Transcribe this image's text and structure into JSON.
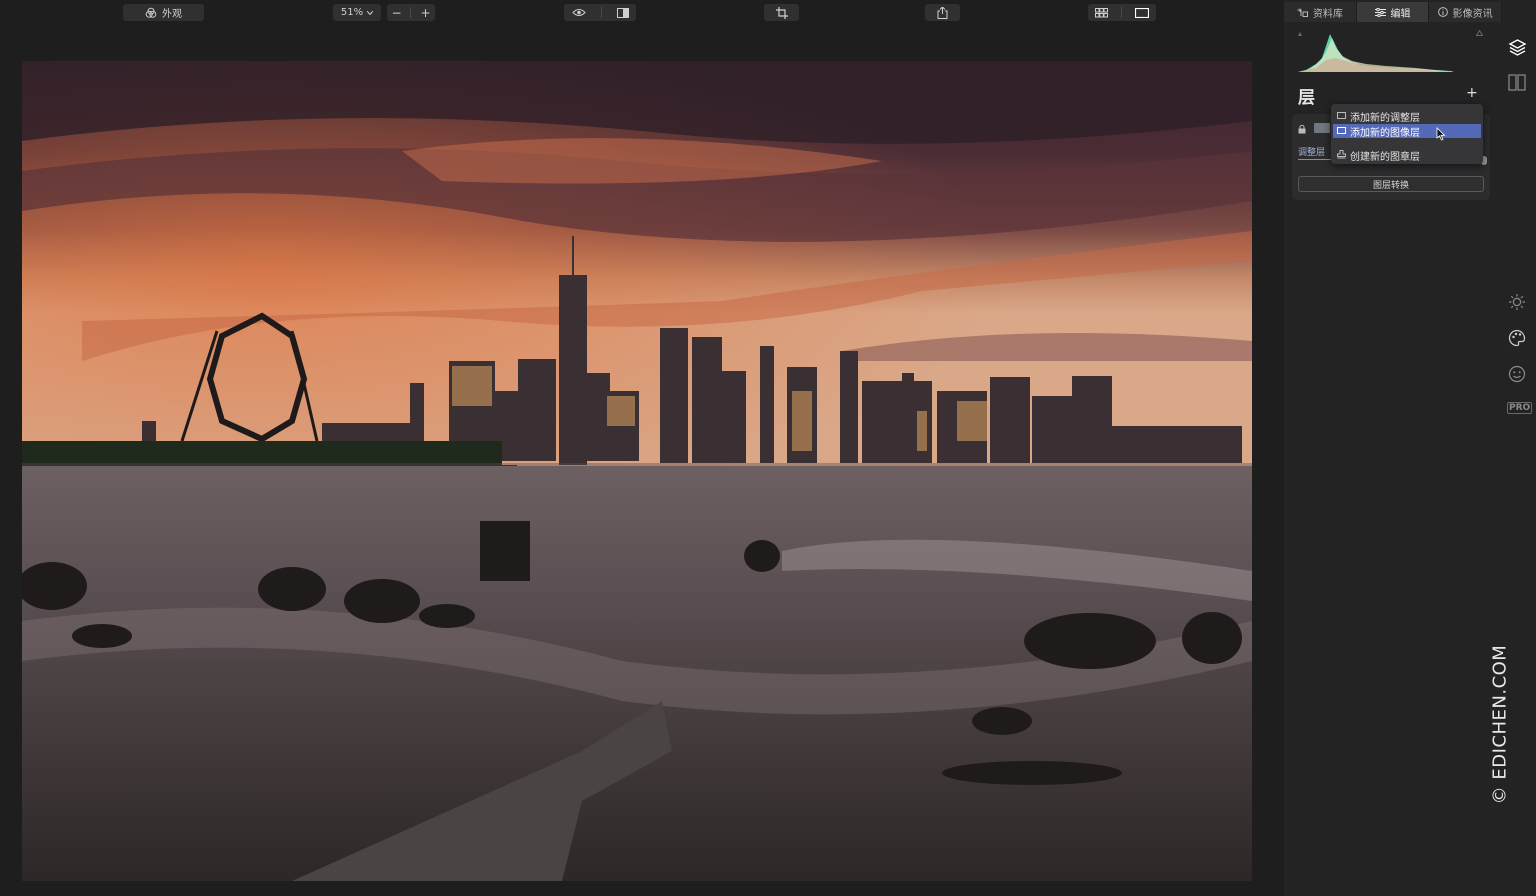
{
  "toolbar": {
    "look_label": "外观",
    "zoom_value": "51%",
    "zoom_minus": "−",
    "zoom_plus": "+"
  },
  "panel": {
    "tabs": [
      {
        "label": "资料库",
        "icon": "library-icon"
      },
      {
        "label": "编辑",
        "icon": "sliders-icon",
        "active": true
      },
      {
        "label": "影像资讯",
        "icon": "info-icon"
      }
    ],
    "layers_title": "层",
    "add_symbol": "+",
    "layer_name": "调整层",
    "convert_button": "图层转换",
    "menu_items": [
      {
        "label": "添加新的调整层",
        "highlighted": false
      },
      {
        "label": "添加新的图像层",
        "highlighted": true
      },
      {
        "label": "创建新的图章层",
        "highlighted": false
      }
    ]
  },
  "rail": {
    "pro_label": "PRO",
    "icons": [
      "layers-icon",
      "compare-icon",
      "sun-icon",
      "palette-icon",
      "face-icon"
    ]
  },
  "watermark": "© EDICHEN.COM",
  "colors": {
    "accent": "#5469b8",
    "background": "#1e1e1f",
    "panel": "#232324"
  }
}
